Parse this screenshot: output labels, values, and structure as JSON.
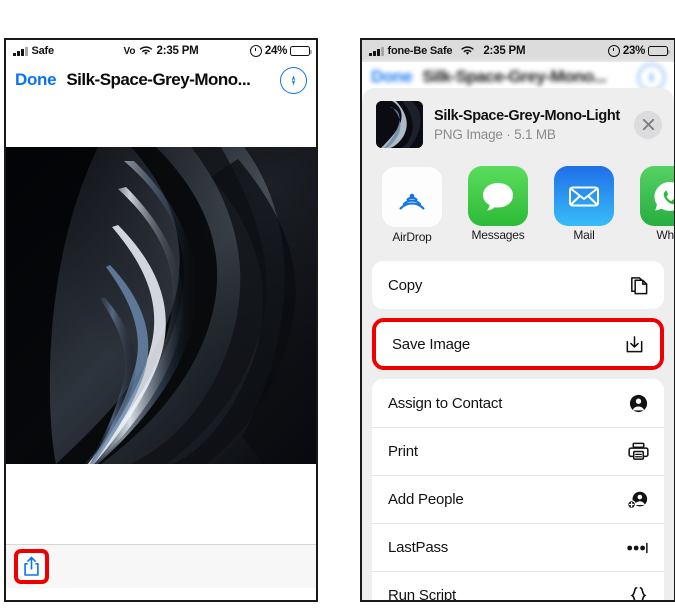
{
  "left_phone": {
    "status_bar": {
      "signal_icon": "cellular-bars-icon",
      "carrier": "Safe",
      "vo_label": "Vo",
      "wifi_icon": "wifi-icon",
      "time": "2:35 PM",
      "alarm_icon": "alarm-clock-icon",
      "battery_pct": "24%",
      "battery_icon": "battery-icon",
      "battery_level": 24
    },
    "nav": {
      "done_label": "Done",
      "title": "Silk-Space-Grey-Mono...",
      "right_icon": "safari-markup-icon"
    },
    "photo": {
      "alt_name": "silk-space-grey-wallpaper"
    },
    "toolbar": {
      "share_icon": "share-upload-icon",
      "highlight_color": "#ef0000"
    }
  },
  "right_phone": {
    "status_bar": {
      "signal_icon": "cellular-bars-icon",
      "carrier": "fone-Be Safe",
      "wifi_icon": "wifi-icon",
      "time": "2:35 PM",
      "alarm_icon": "alarm-clock-icon",
      "battery_pct": "23%",
      "battery_icon": "battery-icon",
      "battery_level": 23
    },
    "background_nav": {
      "done_label": "Done",
      "title": "Silk-Space-Grey-Mono..."
    },
    "share_sheet": {
      "header": {
        "thumbnail_name": "file-thumbnail",
        "title": "Silk-Space-Grey-Mono-Light",
        "subtitle": "PNG Image · 5.1 MB",
        "close_icon": "close-icon"
      },
      "apps": [
        {
          "label": "AirDrop",
          "icon": "airdrop-icon"
        },
        {
          "label": "Messages",
          "icon": "messages-icon"
        },
        {
          "label": "Mail",
          "icon": "mail-icon"
        },
        {
          "label": "What",
          "icon": "whatsapp-icon"
        }
      ],
      "actions": [
        {
          "label": "Copy",
          "icon": "copy-icon",
          "highlighted": false
        },
        {
          "label": "Save Image",
          "icon": "save-download-icon",
          "highlighted": true
        },
        {
          "label": "Assign to Contact",
          "icon": "contact-icon",
          "highlighted": false
        },
        {
          "label": "Print",
          "icon": "printer-icon",
          "highlighted": false
        },
        {
          "label": "Add People",
          "icon": "add-people-icon",
          "highlighted": false
        },
        {
          "label": "LastPass",
          "icon": "lastpass-dots-icon",
          "highlighted": false
        },
        {
          "label": "Run Script",
          "icon": "braces-icon",
          "highlighted": false
        }
      ],
      "highlight_color": "#ef0000"
    }
  }
}
